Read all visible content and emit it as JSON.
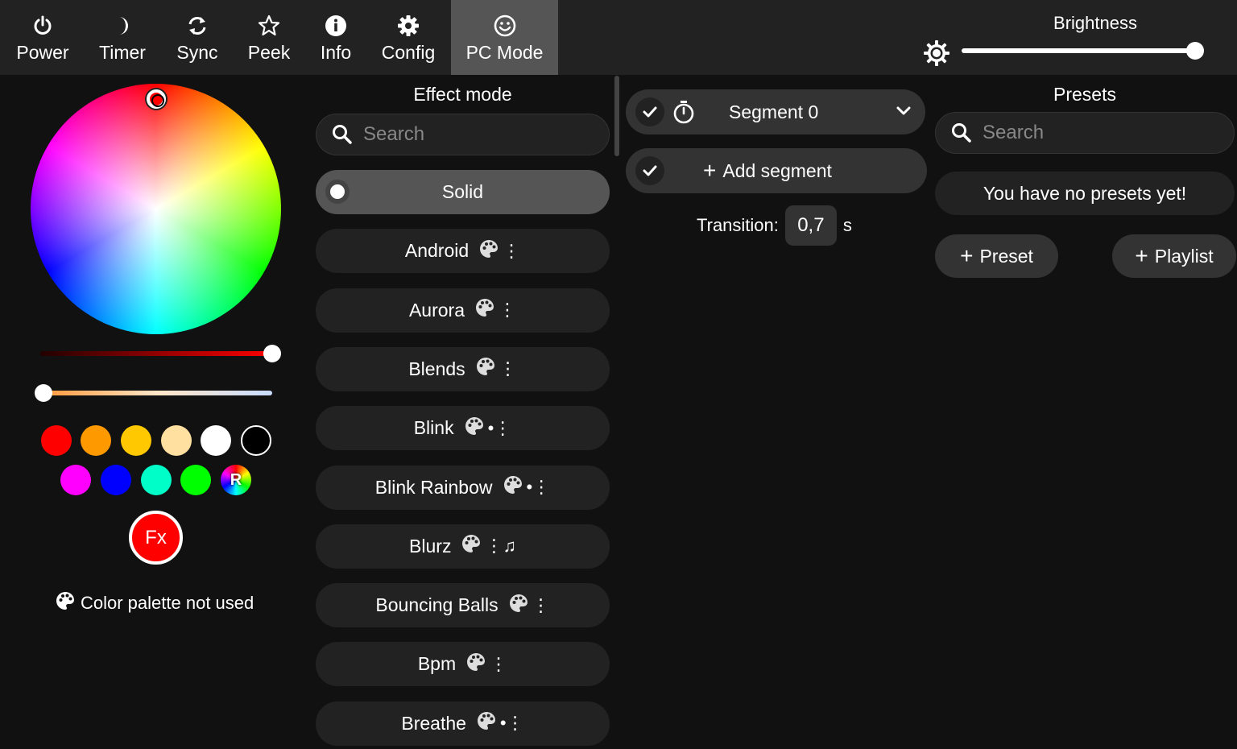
{
  "nav": [
    {
      "label": "Power",
      "icon": "power-icon"
    },
    {
      "label": "Timer",
      "icon": "moon-icon"
    },
    {
      "label": "Sync",
      "icon": "sync-icon"
    },
    {
      "label": "Peek",
      "icon": "star-icon"
    },
    {
      "label": "Info",
      "icon": "info-icon"
    },
    {
      "label": "Config",
      "icon": "gear-icon"
    },
    {
      "label": "PC Mode",
      "icon": "smiley-icon",
      "active": true
    }
  ],
  "brightness": {
    "label": "Brightness",
    "value": 1.0
  },
  "color": {
    "brightness_slider": 1.0,
    "white_balance_slider": 0.0,
    "swatches_row1": [
      "#ff0000",
      "#ff9900",
      "#ffc800",
      "#ffe0a0",
      "#ffffff",
      "#000000"
    ],
    "swatches_row2": [
      "#ff00ff",
      "#0000ff",
      "#00ffc8",
      "#00ff00"
    ],
    "random_label": "R",
    "fx_label": "Fx",
    "palette_note": "Color palette not used"
  },
  "effects": {
    "title": "Effect mode",
    "search_placeholder": "Search",
    "items": [
      {
        "name": "Solid",
        "flags": "",
        "selected": true
      },
      {
        "name": "Android",
        "flags": "⋮"
      },
      {
        "name": "Aurora",
        "flags": "⋮"
      },
      {
        "name": "Blends",
        "flags": "⋮"
      },
      {
        "name": "Blink",
        "flags": "•⋮"
      },
      {
        "name": "Blink Rainbow",
        "flags": "•⋮"
      },
      {
        "name": "Blurz",
        "flags": "⋮♫"
      },
      {
        "name": "Bouncing Balls",
        "flags": "⋮"
      },
      {
        "name": "Bpm",
        "flags": "⋮"
      },
      {
        "name": "Breathe",
        "flags": "•⋮"
      }
    ]
  },
  "segments": {
    "segment_label": "Segment 0",
    "add_label": "Add segment",
    "transition_label": "Transition:",
    "transition_value": "0,7",
    "transition_unit": "s"
  },
  "presets": {
    "title": "Presets",
    "search_placeholder": "Search",
    "empty_text": "You have no presets yet!",
    "add_preset_label": "Preset",
    "add_playlist_label": "Playlist"
  }
}
